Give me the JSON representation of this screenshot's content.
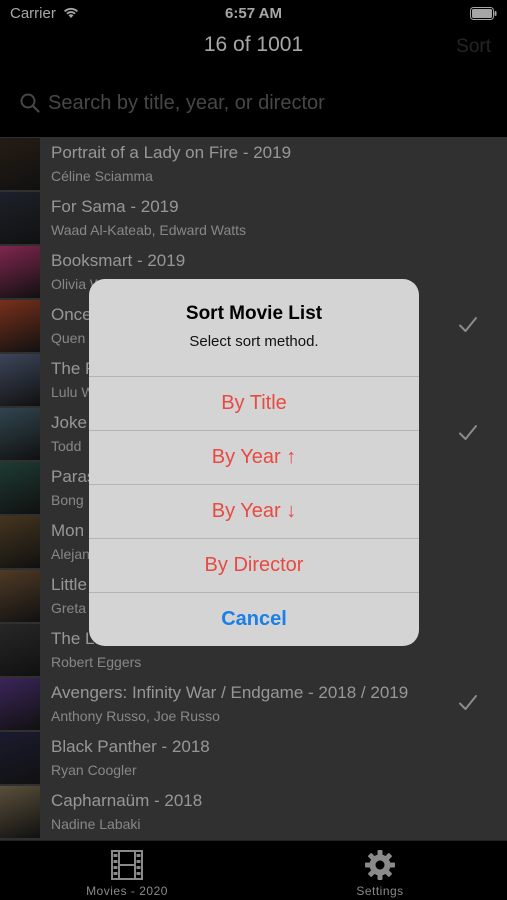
{
  "status_bar": {
    "carrier": "Carrier",
    "time": "6:57 AM"
  },
  "nav": {
    "title": "16 of 1001",
    "sort_label": "Sort"
  },
  "search": {
    "placeholder": "Search by title, year, or director"
  },
  "movies": [
    {
      "title": "Portrait of a Lady on Fire - 2019",
      "director": "Céline Sciamma",
      "checked": false,
      "poster_color": "#3a2b20"
    },
    {
      "title": "For Sama - 2019",
      "director": "Waad Al-Kateab, Edward Watts",
      "checked": false,
      "poster_color": "#2d3340"
    },
    {
      "title": "Booksmart - 2019",
      "director": "Olivia Wilde",
      "checked": false,
      "poster_color": "#c43b78"
    },
    {
      "title": "Once",
      "director": "Quen",
      "checked": true,
      "poster_color": "#b84a2a"
    },
    {
      "title": "The F",
      "director": "Lulu W",
      "checked": false,
      "poster_color": "#5c6b8a"
    },
    {
      "title": "Joke",
      "director": "Todd",
      "checked": true,
      "poster_color": "#4b6a7a"
    },
    {
      "title": "Paras",
      "director": "Bong",
      "checked": false,
      "poster_color": "#2f5a4f"
    },
    {
      "title": "Mon",
      "director": "Alejan",
      "checked": false,
      "poster_color": "#6a5230"
    },
    {
      "title": "Little",
      "director": "Greta",
      "checked": false,
      "poster_color": "#7a5a3a"
    },
    {
      "title": "The L",
      "director": "Robert Eggers",
      "checked": false,
      "poster_color": "#3c3c3c"
    },
    {
      "title": "Avengers: Infinity War / Endgame - 2018 / 2019",
      "director": "Anthony Russo, Joe Russo",
      "checked": true,
      "poster_color": "#5a3a8a"
    },
    {
      "title": "Black Panther - 2018",
      "director": "Ryan Coogler",
      "checked": false,
      "poster_color": "#2a2a4a"
    },
    {
      "title": "Capharnaüm - 2018",
      "director": "Nadine Labaki",
      "checked": false,
      "poster_color": "#8a7a5a"
    }
  ],
  "alert": {
    "title": "Sort Movie List",
    "message": "Select sort method.",
    "options": [
      "By Title",
      "By Year ↑",
      "By Year ↓",
      "By Director"
    ],
    "cancel": "Cancel",
    "action_color": "#e84a42",
    "cancel_color": "#1a7fe8"
  },
  "tabs": [
    {
      "label": "Movies - 2020",
      "icon": "film-icon"
    },
    {
      "label": "Settings",
      "icon": "gear-icon"
    }
  ]
}
